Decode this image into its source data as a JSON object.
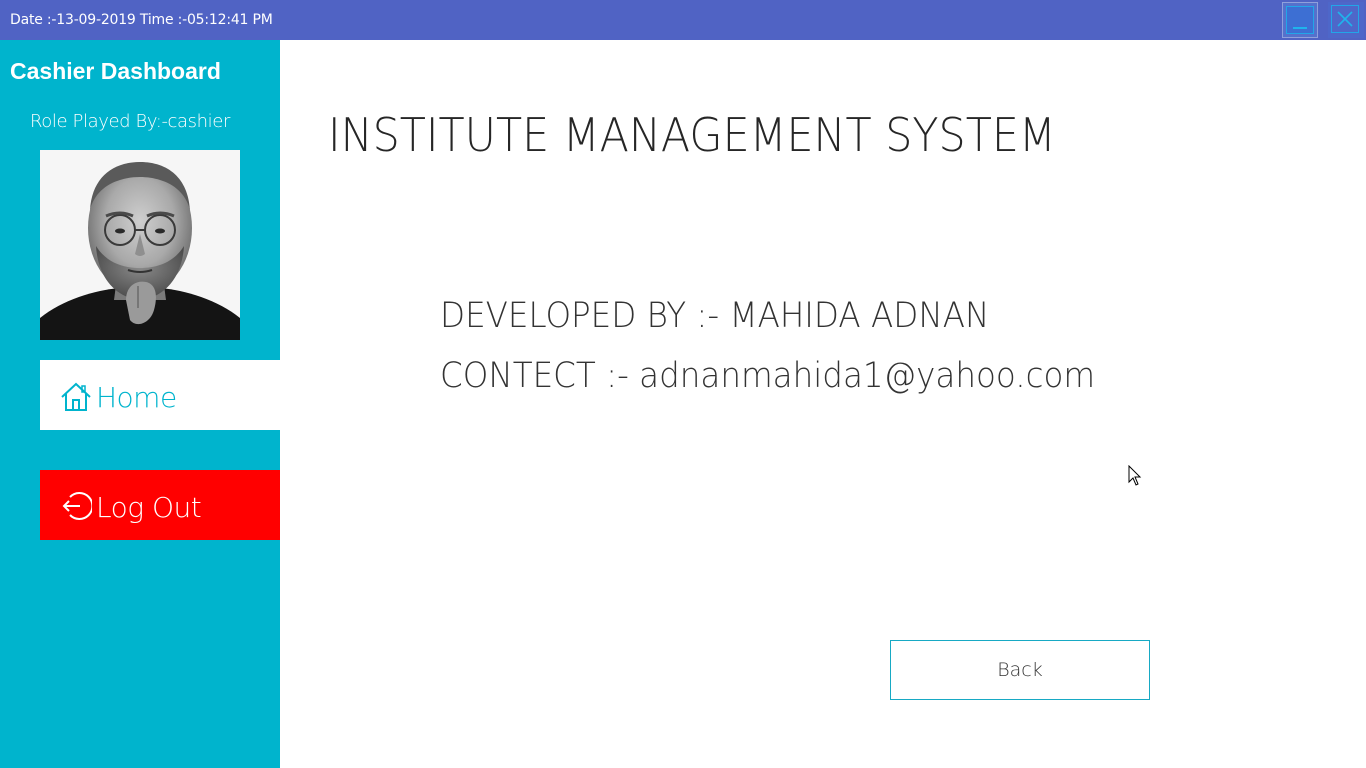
{
  "titlebar": {
    "text": "Date :-13-09-2019 Time :-05:12:41 PM"
  },
  "sidebar": {
    "title": "Cashier Dashboard",
    "role": "Role Played By:-cashier",
    "home_label": "Home",
    "logout_label": "Log Out"
  },
  "main": {
    "title": "INSTITUTE MANAGEMENT SYSTEM",
    "developed_by": "DEVELOPED BY :- MAHIDA ADNAN",
    "contact": "CONTECT :- adnanmahida1@yahoo.com",
    "back_label": "Back"
  },
  "colors": {
    "titlebar": "#5063c4",
    "sidebar": "#00b4cd",
    "logout": "#ff0000",
    "accent": "#00b4cd"
  },
  "icons": {
    "home": "house-icon",
    "logout": "logout-arrow-icon",
    "minimize": "minimize-icon",
    "close": "close-icon"
  }
}
